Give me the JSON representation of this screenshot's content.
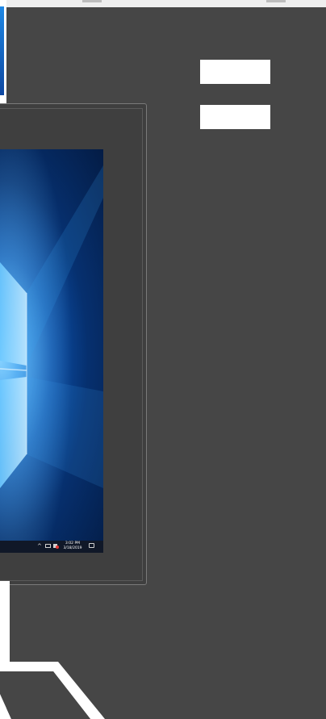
{
  "taskbar": {
    "time": "3:02 PM",
    "date": "3/18/2019"
  },
  "side_buttons": [
    {
      "label": ""
    },
    {
      "label": ""
    }
  ],
  "colors": {
    "background": "#464646",
    "desktop_accent": "#2f8ee6",
    "button": "#ffffff"
  },
  "icons": [
    "chevron-up-icon",
    "network-icon",
    "volume-icon",
    "notification-icon",
    "windows-logo-icon"
  ]
}
